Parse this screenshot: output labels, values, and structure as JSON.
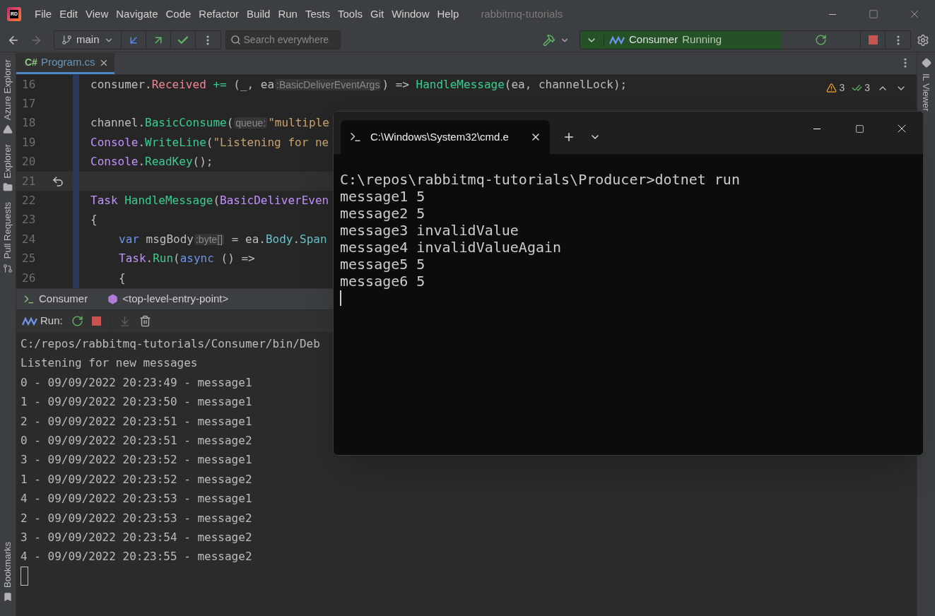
{
  "title_bar": {
    "logo": "RD",
    "menus": [
      "File",
      "Edit",
      "View",
      "Navigate",
      "Code",
      "Refactor",
      "Build",
      "Run",
      "Tests",
      "Tools",
      "Git",
      "Window",
      "Help"
    ],
    "project": "rabbitmq-tutorials"
  },
  "toolbar": {
    "branch": "main",
    "search": {
      "placeholder": "Search everywhere"
    },
    "run_config": {
      "name": "Consumer",
      "status": "Running"
    }
  },
  "left_strip": [
    {
      "label": "Azure Explorer",
      "kind": "azure"
    },
    {
      "label": "Explorer",
      "kind": "folder"
    },
    {
      "label": "Pull Requests",
      "kind": "pull"
    }
  ],
  "left_bottom": [
    {
      "label": "Bookmarks",
      "kind": "bookmark"
    }
  ],
  "right_strip": [
    {
      "label": "IL Viewer"
    }
  ],
  "editor_tabs": [
    {
      "lang": "C#",
      "label": "Program.cs",
      "selected": true
    }
  ],
  "inspections": {
    "warnings": "3",
    "passed": "3"
  },
  "code_lines": [
    {
      "number": "16",
      "current": false,
      "reverted": false,
      "indented": false,
      "tokens": [
        {
          "kind": "plain",
          "text": "consumer."
        },
        {
          "kind": "event",
          "text": "Received"
        },
        {
          "kind": "op",
          "text": " +="
        },
        {
          "kind": "plain",
          "text": " (_, ea"
        },
        {
          "kind": "hint",
          "text": ":BasicDeliverEventArgs"
        },
        {
          "kind": "plain",
          "text": ") => "
        },
        {
          "kind": "method",
          "text": "HandleMessage"
        },
        {
          "kind": "plain",
          "text": "(ea, channelLock);"
        }
      ]
    },
    {
      "number": "17",
      "current": false,
      "reverted": false
    },
    {
      "number": "18",
      "current": false,
      "reverted": false,
      "indented": false,
      "tokens": [
        {
          "kind": "plain",
          "text": "channel."
        },
        {
          "kind": "method",
          "text": "BasicConsume"
        },
        {
          "kind": "plain",
          "text": "("
        },
        {
          "kind": "hint",
          "text": "queue:"
        },
        {
          "kind": "string",
          "text": "\"multiple"
        }
      ]
    },
    {
      "number": "19",
      "current": false,
      "reverted": false,
      "indented": false,
      "tokens": [
        {
          "kind": "type",
          "text": "Console"
        },
        {
          "kind": "plain",
          "text": "."
        },
        {
          "kind": "method",
          "text": "WriteLine"
        },
        {
          "kind": "plain",
          "text": "("
        },
        {
          "kind": "string",
          "text": "\"Listening for ne"
        }
      ]
    },
    {
      "number": "20",
      "current": false,
      "reverted": false,
      "indented": false,
      "tokens": [
        {
          "kind": "type",
          "text": "Console"
        },
        {
          "kind": "plain",
          "text": "."
        },
        {
          "kind": "method",
          "text": "ReadKey"
        },
        {
          "kind": "plain",
          "text": "();"
        }
      ]
    },
    {
      "number": "21",
      "current": true,
      "reverted": true
    },
    {
      "number": "22",
      "current": false,
      "reverted": false,
      "indented": false,
      "tokens": [
        {
          "kind": "type",
          "text": "Task "
        },
        {
          "kind": "method",
          "text": "HandleMessage"
        },
        {
          "kind": "plain",
          "text": "("
        },
        {
          "kind": "type",
          "text": "BasicDeliverEven"
        }
      ]
    },
    {
      "number": "23",
      "current": false,
      "reverted": false,
      "indented": false,
      "tokens": [
        {
          "kind": "plain",
          "text": "{"
        }
      ]
    },
    {
      "number": "24",
      "current": false,
      "reverted": false,
      "indented": true,
      "tokens": [
        {
          "kind": "keyword",
          "text": "var"
        },
        {
          "kind": "plain",
          "text": " msgBody"
        },
        {
          "kind": "hint",
          "text": ":byte[]"
        },
        {
          "kind": "plain",
          "text": " = ea."
        },
        {
          "kind": "field",
          "text": "Body"
        },
        {
          "kind": "plain",
          "text": "."
        },
        {
          "kind": "field",
          "text": "Span"
        }
      ]
    },
    {
      "number": "25",
      "current": false,
      "reverted": false,
      "indented": true,
      "tokens": [
        {
          "kind": "type",
          "text": "Task"
        },
        {
          "kind": "plain",
          "text": "."
        },
        {
          "kind": "method",
          "text": "Run"
        },
        {
          "kind": "plain",
          "text": "("
        },
        {
          "kind": "keyword",
          "text": "async"
        },
        {
          "kind": "plain",
          "text": " () =>"
        }
      ]
    },
    {
      "number": "26",
      "current": false,
      "reverted": false,
      "indented": true,
      "tokens": [
        {
          "kind": "plain",
          "text": "{"
        }
      ]
    }
  ],
  "run_panel": {
    "tabs": [
      {
        "label": "Consumer",
        "kind": "config"
      },
      {
        "label": "<top-level-entry-point>",
        "kind": "entry"
      }
    ],
    "run_label": "Run:",
    "output": [
      "C:/repos/rabbitmq-tutorials/Consumer/bin/Deb",
      "Listening for new messages",
      "0 - 09/09/2022 20:23:49 - message1",
      "1 - 09/09/2022 20:23:50 - message1",
      "2 - 09/09/2022 20:23:51 - message1",
      "0 - 09/09/2022 20:23:51 - message2",
      "3 - 09/09/2022 20:23:52 - message1",
      "1 - 09/09/2022 20:23:52 - message2",
      "4 - 09/09/2022 20:23:53 - message1",
      "2 - 09/09/2022 20:23:53 - message2",
      "3 - 09/09/2022 20:23:54 - message2",
      "4 - 09/09/2022 20:23:55 - message2"
    ]
  },
  "terminal": {
    "tab_title": "C:\\Windows\\System32\\cmd.e",
    "lines": [
      "C:\\repos\\rabbitmq-tutorials\\Producer>dotnet run",
      "message1 5",
      "message2 5",
      "message3 invalidValue",
      "message4 invalidValueAgain",
      "message5 5",
      "message6 5"
    ]
  }
}
